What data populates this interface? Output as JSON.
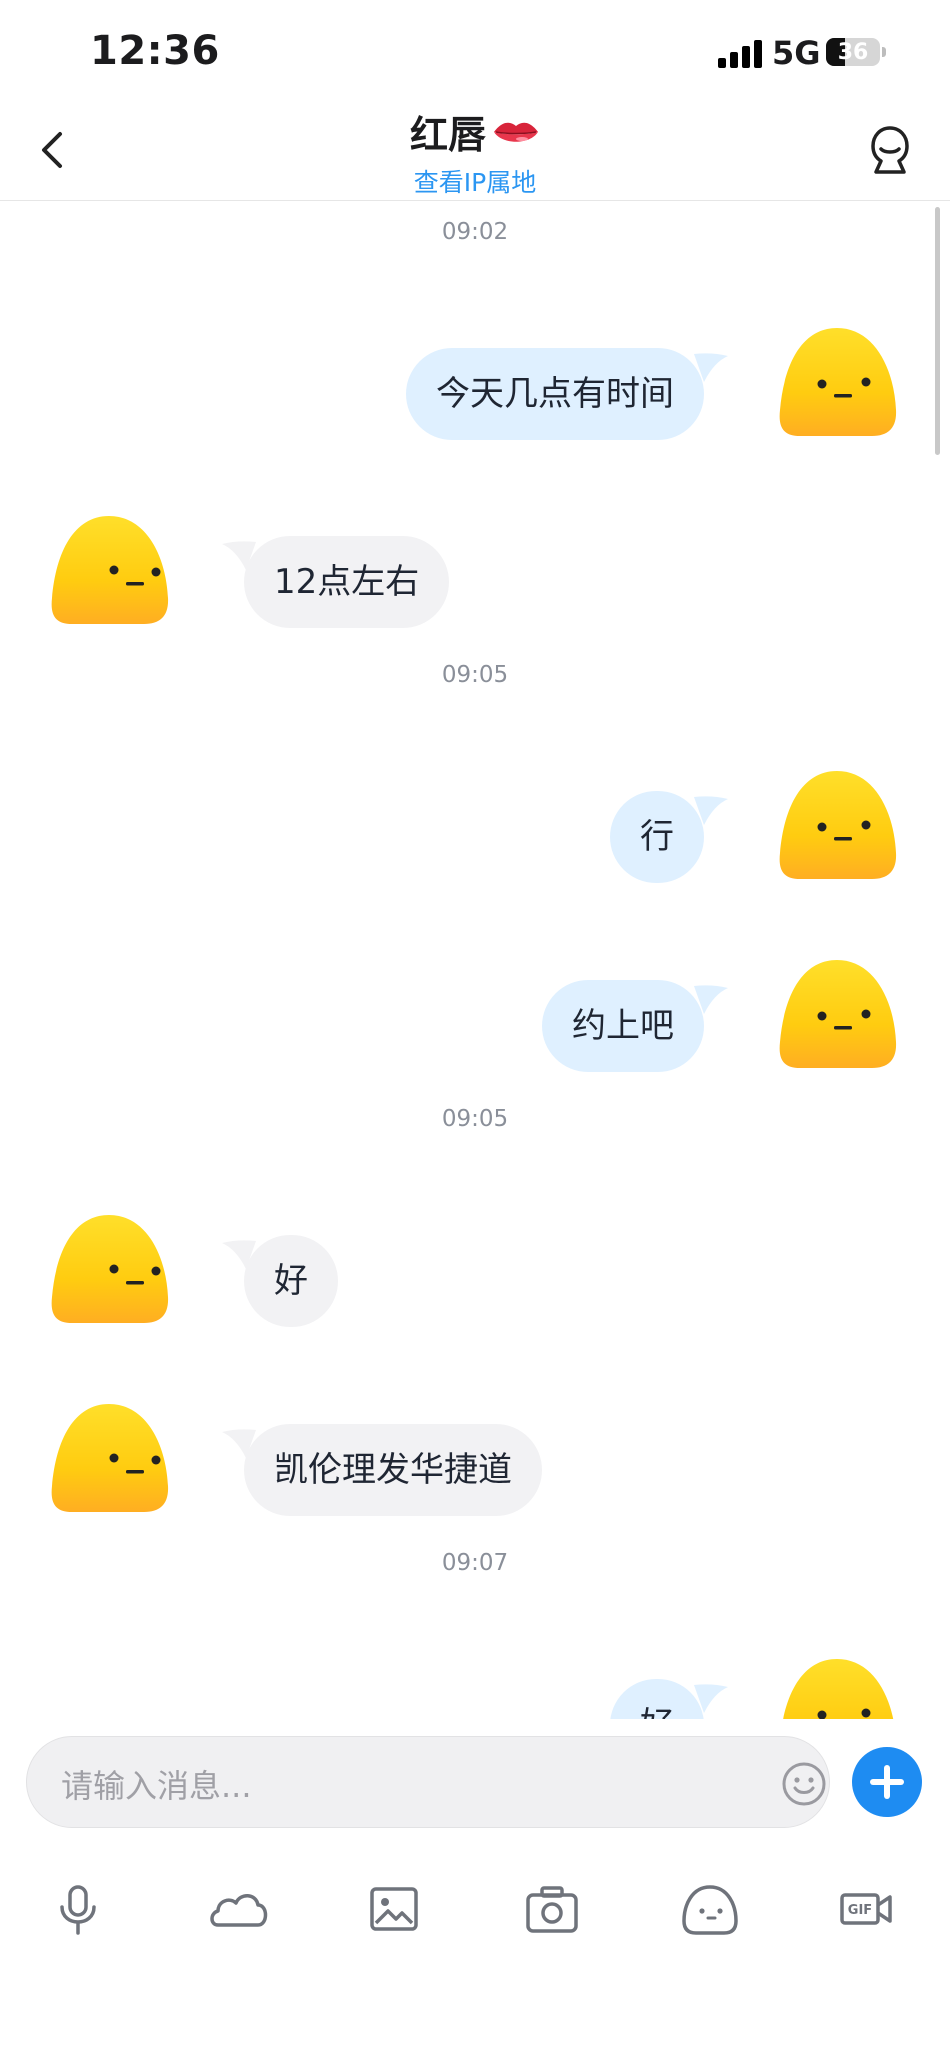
{
  "status_bar": {
    "time": "12:36",
    "network": "5G",
    "battery": "36",
    "battery_level": 0.36
  },
  "header": {
    "title": "红唇",
    "title_emoji_icon": "lips-icon",
    "subtitle_link": "查看IP属地",
    "back_icon": "chevron-left-icon",
    "profile_icon": "user-profile-icon"
  },
  "chat": {
    "timestamps": [
      "09:02",
      "09:05",
      "09:05",
      "09:07"
    ],
    "messages": [
      {
        "from": "me",
        "text": "今天几点有时间"
      },
      {
        "from": "them",
        "text": "12点左右"
      },
      {
        "from": "me",
        "text": "行"
      },
      {
        "from": "me",
        "text": "约上吧"
      },
      {
        "from": "them",
        "text": "好"
      },
      {
        "from": "them",
        "text": "凯伦理发华捷道"
      },
      {
        "from": "me",
        "text": "好"
      }
    ],
    "colors": {
      "my_bubble": "#dff0ff",
      "their_bubble": "#f2f2f4",
      "avatar": "#ffd21a"
    }
  },
  "input": {
    "placeholder": "请输入消息...",
    "emoji_icon": "smiley-icon",
    "plus_icon": "plus-icon",
    "accent": "#1e8cf2"
  },
  "toolbar": {
    "items": [
      {
        "icon": "microphone-icon"
      },
      {
        "icon": "cloud-icon"
      },
      {
        "icon": "image-icon"
      },
      {
        "icon": "camera-icon"
      },
      {
        "icon": "sticker-icon"
      },
      {
        "icon": "gif-icon",
        "label": "GIF"
      }
    ]
  }
}
